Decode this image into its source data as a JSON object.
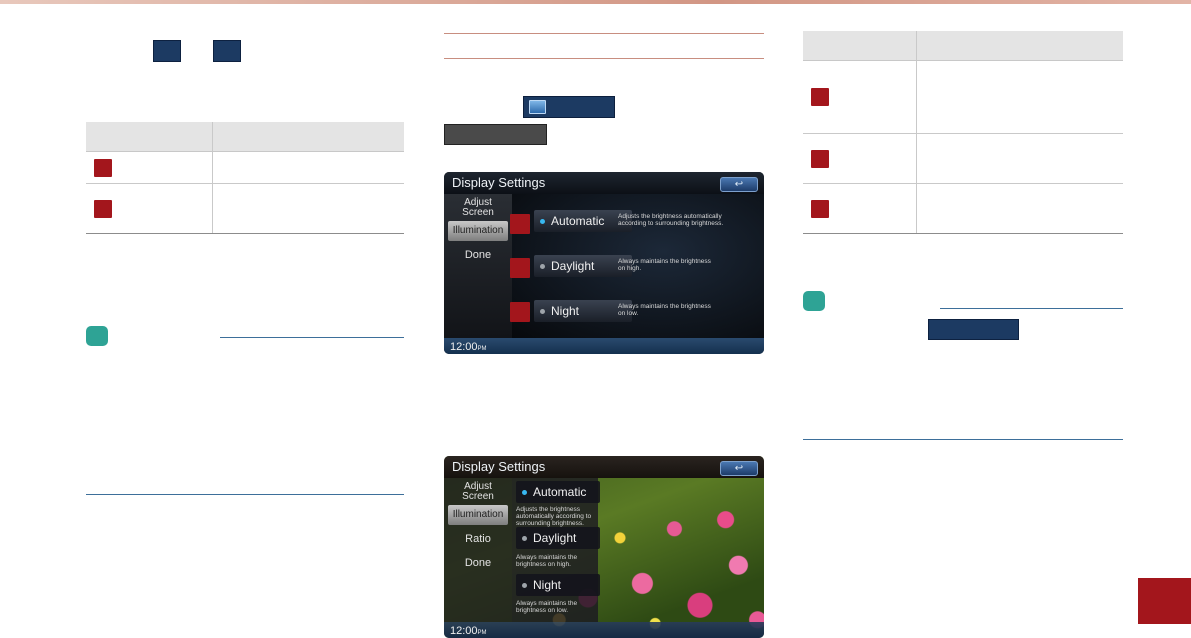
{
  "screens": [
    {
      "title": "Display Settings",
      "back": "↩",
      "sidebar": [
        {
          "label": "Adjust\nScreen"
        },
        {
          "label": "Illumination",
          "selected": true
        },
        {
          "label": "Done"
        }
      ],
      "options": [
        {
          "label": "Automatic",
          "desc": "Adjusts the brightness automatically\naccording to surrounding brightness."
        },
        {
          "label": "Daylight",
          "desc": "Always maintains the brightness\non high."
        },
        {
          "label": "Night",
          "desc": "Always maintains the brightness\non low."
        }
      ],
      "clock": "12:00",
      "clock_suffix": "PM"
    },
    {
      "title": "Display Settings",
      "back": "↩",
      "sidebar": [
        {
          "label": "Adjust\nScreen"
        },
        {
          "label": "Illumination",
          "selected": true
        },
        {
          "label": "Ratio"
        },
        {
          "label": "Done"
        }
      ],
      "options": [
        {
          "label": "Automatic",
          "desc": "Adjusts the brightness automatically according to surrounding brightness."
        },
        {
          "label": "Daylight",
          "desc": "Always maintains the brightness on high."
        },
        {
          "label": "Night",
          "desc": "Always maintains the brightness on low."
        }
      ],
      "clock": "12:00",
      "clock_suffix": "PM"
    }
  ],
  "colors": {
    "accent_red": "#a3161c",
    "navy": "#1c3a62",
    "teal": "#2ea395",
    "rule_blue": "#3d6f9a"
  }
}
